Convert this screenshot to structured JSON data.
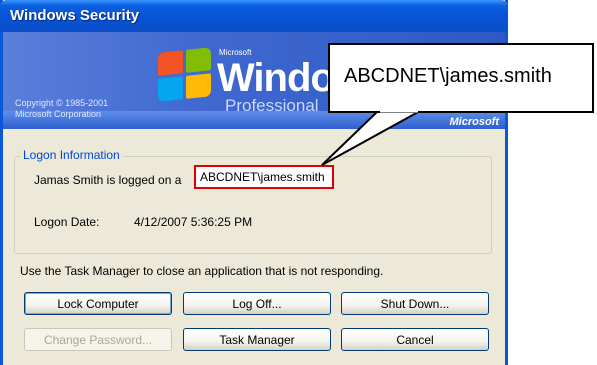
{
  "window": {
    "title": "Windows Security"
  },
  "banner": {
    "copyright_line1": "Copyright © 1985-2001",
    "copyright_line2": "Microsoft Corporation",
    "ms_small": "Microsoft",
    "windows_word": "Windov",
    "edition": "Professional",
    "brand": "Microsoft"
  },
  "logon": {
    "group_title": "Logon Information",
    "logged_on_prefix": "Jamas Smith is logged on a",
    "account": "ABCDNET\\james.smith",
    "date_label": "Logon Date:",
    "date_value": "4/12/2007 5:36:25 PM"
  },
  "hint": "Use the Task Manager to close an application that is not responding.",
  "buttons": {
    "lock": "Lock Computer",
    "logoff": "Log Off...",
    "shutdown": "Shut Down...",
    "change_password": "Change Password...",
    "task_manager": "Task Manager",
    "cancel": "Cancel"
  },
  "callout": {
    "text": "ABCDNET\\james.smith"
  },
  "colors": {
    "title_bar": "#0a5fe0",
    "highlight_border": "#e10000",
    "group_title": "#0046d5"
  }
}
